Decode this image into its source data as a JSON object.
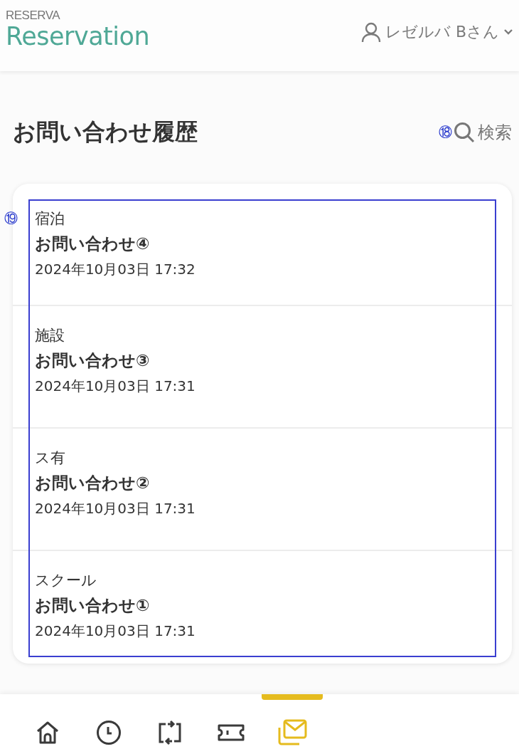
{
  "header": {
    "brand_small": "RESERVA",
    "brand": "Reservation",
    "user": "レゼルバ Bさん"
  },
  "page": {
    "title": "お問い合わせ履歴",
    "search": "検索",
    "search_callout": "⑱",
    "list_callout": "⑲"
  },
  "inquiries": [
    {
      "category": "宿泊",
      "subject": "お問い合わせ④",
      "datetime": "2024年10月03日 17:32"
    },
    {
      "category": "施設",
      "subject": "お問い合わせ③",
      "datetime": "2024年10月03日 17:31"
    },
    {
      "category": "ス有",
      "subject": "お問い合わせ②",
      "datetime": "2024年10月03日 17:31"
    },
    {
      "category": "スクール",
      "subject": "お問い合わせ①",
      "datetime": "2024年10月03日 17:31"
    }
  ],
  "nav": [
    {
      "kind": "home",
      "selected": false
    },
    {
      "kind": "history",
      "selected": false
    },
    {
      "kind": "transfer",
      "selected": false
    },
    {
      "kind": "ticket",
      "selected": false
    },
    {
      "kind": "mail",
      "selected": true
    }
  ]
}
